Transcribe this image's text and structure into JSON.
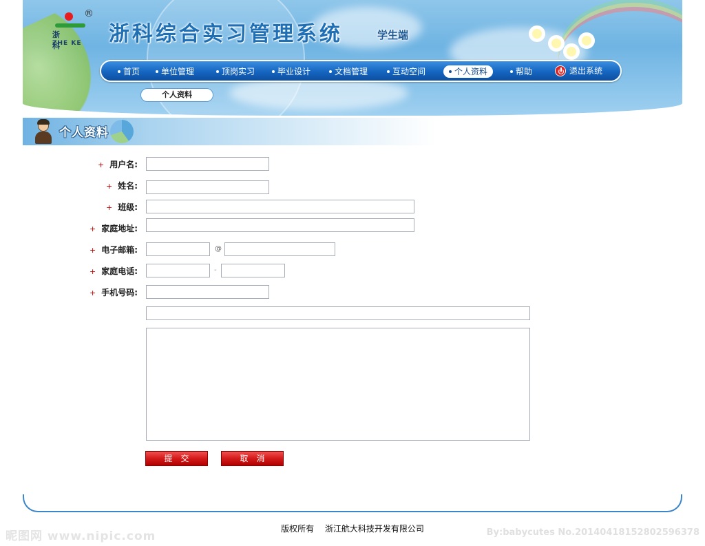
{
  "header": {
    "logo": {
      "cn": "浙科",
      "en": "ZHE KE",
      "reg": "®"
    },
    "title": "浙科综合实习管理系统",
    "subtitle": "学生端"
  },
  "nav": {
    "items": [
      {
        "label": "首页"
      },
      {
        "label": "单位管理"
      },
      {
        "label": "顶岗实习"
      },
      {
        "label": "毕业设计"
      },
      {
        "label": "文档管理"
      },
      {
        "label": "互动空间"
      },
      {
        "label": "个人资料",
        "active": true
      },
      {
        "label": "帮助"
      }
    ],
    "logout_label": "退出系统"
  },
  "subnav": {
    "label": "个人资料"
  },
  "section": {
    "title": "个人资料"
  },
  "form": {
    "required_mark": "+",
    "username_label": "用户名:",
    "name_label": "姓名:",
    "class_label": "班级:",
    "address_label": "家庭地址:",
    "email_label": "电子邮箱:",
    "email_at": "@",
    "phone_label": "家庭电话:",
    "phone_dash": "-",
    "mobile_label": "手机号码:",
    "username_value": "",
    "name_value": "",
    "class_value": "",
    "address_value": "",
    "email_user_value": "",
    "email_domain_value": "",
    "phone_area_value": "",
    "phone_number_value": "",
    "mobile_value": "",
    "extra_value": "",
    "notes_value": ""
  },
  "buttons": {
    "submit": "提交",
    "cancel": "取消"
  },
  "footer": {
    "rights": "版权所有",
    "company": "浙江航大科技开发有限公司"
  },
  "watermark": {
    "left": "昵图网 www.nipic.com",
    "right": "By:babycutes No.20140418152802596378"
  },
  "colors": {
    "nav_blue": "#1565c0",
    "required_red": "#c40000",
    "button_red": "#d41a1a",
    "footer_blue": "#3c85c8"
  }
}
